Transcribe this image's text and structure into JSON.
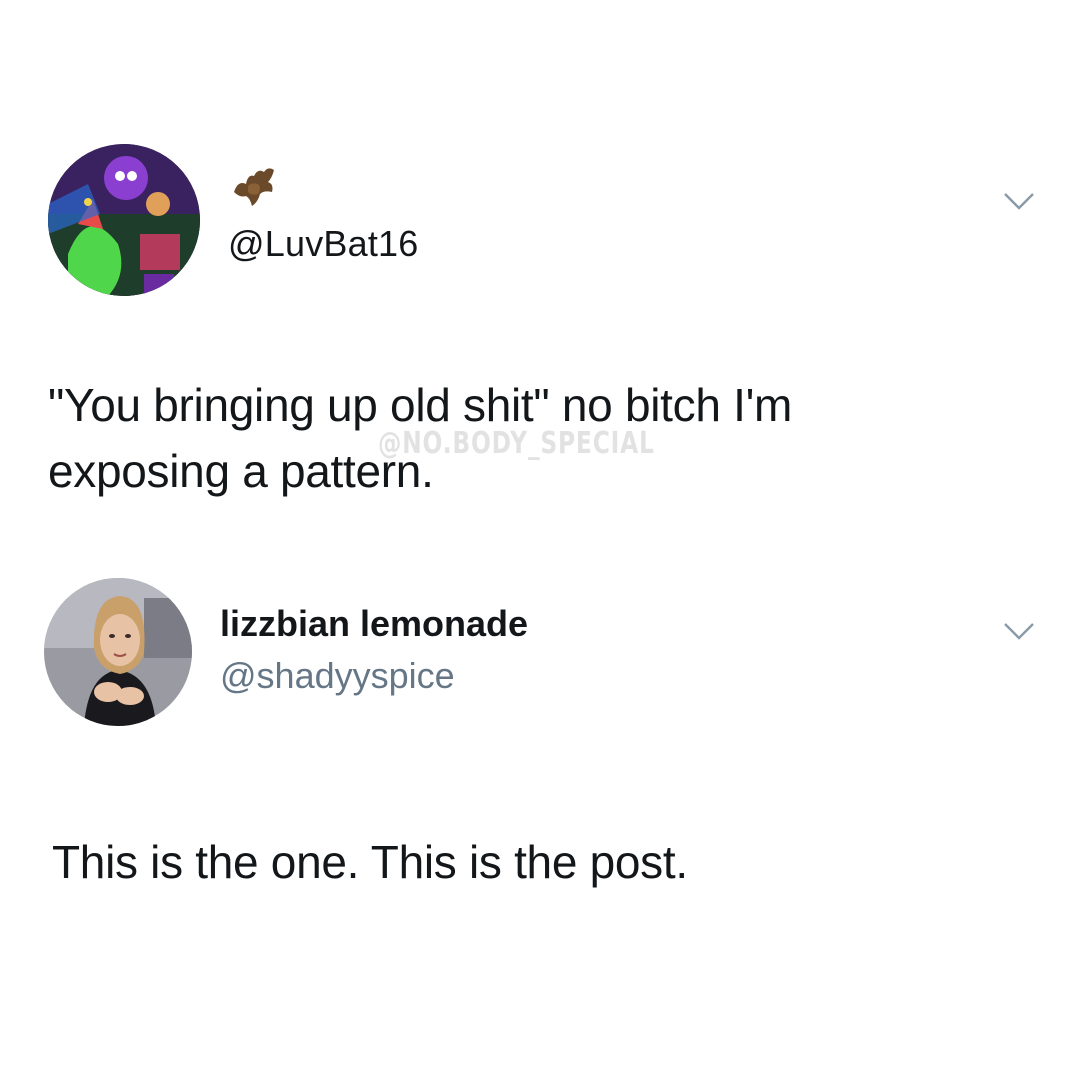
{
  "quoted_tweet": {
    "handle": "@LuvBat16",
    "bat_emoji": "bat-icon",
    "text_line_1": "\"You bringing up old shit\" no bitch I'm",
    "text_line_2": "exposing a pattern.",
    "menu_icon": "chevron-down-icon"
  },
  "reply_tweet": {
    "display_name": "lizzbian lemonade",
    "handle": "@shadyyspice",
    "text": "This is the one. This is the post.",
    "menu_icon": "chevron-down-icon"
  },
  "watermark": "@NO.BODY_SPECIAL",
  "colors": {
    "text": "#14171a",
    "secondary_text": "#657786",
    "chevron": "#8a9aa6",
    "background": "#ffffff"
  }
}
